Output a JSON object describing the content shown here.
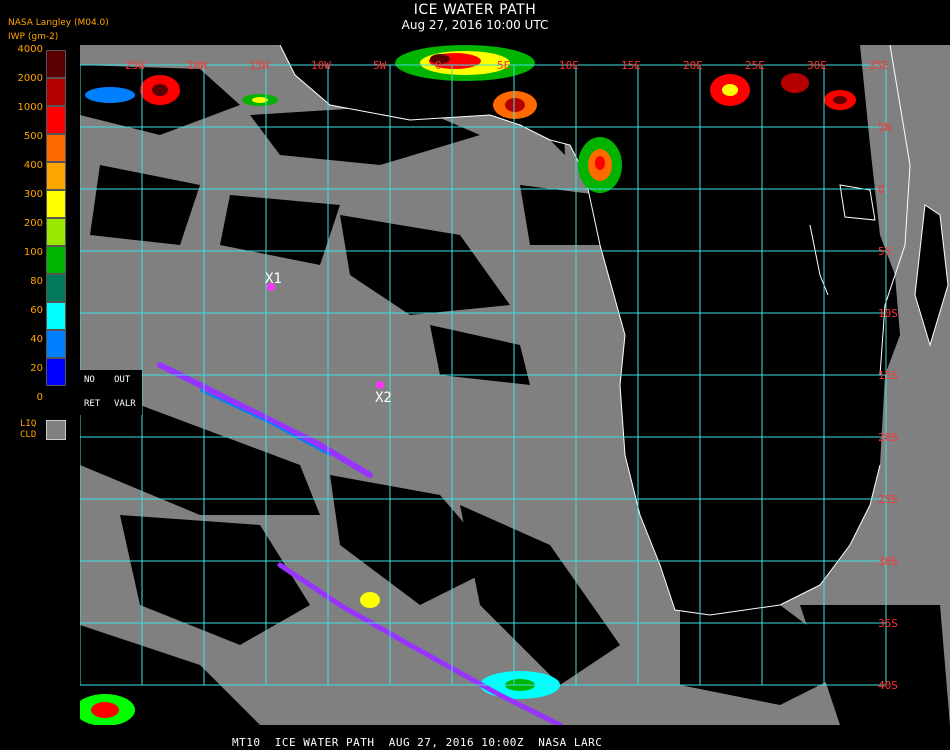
{
  "header": {
    "title": "ICE WATER PATH",
    "subtitle": "Aug 27, 2016 10:00 UTC",
    "source": "NASA Langley (M04.0)",
    "unit_label": "IWP (gm-2)"
  },
  "legend": {
    "ticks": [
      "4000",
      "2000",
      "1000",
      "500",
      "400",
      "300",
      "200",
      "100",
      "80",
      "60",
      "40",
      "20",
      "0"
    ],
    "colors": [
      "#5a0000",
      "#b40000",
      "#ff0000",
      "#ff6a00",
      "#ffa500",
      "#ffff00",
      "#98e800",
      "#00b400",
      "#007a5a",
      "#00ffff",
      "#0080ff",
      "#0000ff",
      "#9933ff"
    ],
    "no_retrieval": [
      "NO",
      "OUT",
      "RET",
      "VALR"
    ],
    "liquid_label": [
      "LIQ",
      "CLD"
    ],
    "liquid_color": "#808080"
  },
  "map": {
    "lon_labels": [
      "25W",
      "20W",
      "15W",
      "10W",
      "5W",
      "0",
      "5E",
      "10E",
      "15E",
      "20E",
      "25E",
      "30E",
      "35E"
    ],
    "lat_labels": [
      "5N",
      "0",
      "5S",
      "10S",
      "15S",
      "20S",
      "25S",
      "30S",
      "35S",
      "40S"
    ],
    "markers": [
      {
        "label": "X1",
        "color": "#ff33ff"
      },
      {
        "label": "X2",
        "color": "#ff33ff"
      }
    ],
    "grid_color": "#40e0e0",
    "label_color": "#ff3333",
    "land_color": "#000000",
    "cloud_color": "#808080"
  },
  "footer": "MT10  ICE WATER PATH  AUG 27, 2016 10:00Z  NASA LARC"
}
